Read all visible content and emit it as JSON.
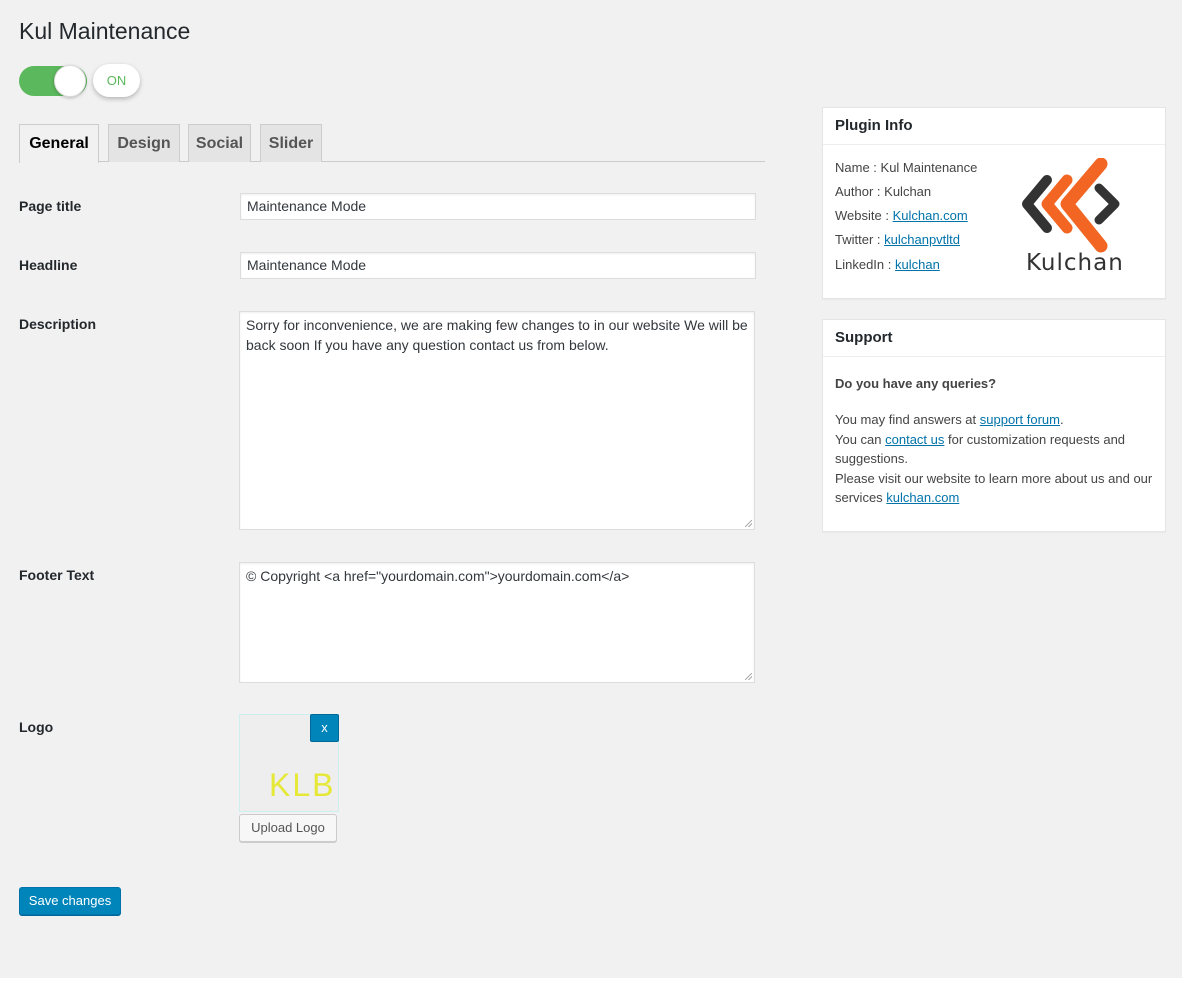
{
  "page": {
    "title": "Kul Maintenance"
  },
  "toggle": {
    "state_label": "ON",
    "on_color": "#5cb85c"
  },
  "tabs": [
    {
      "label": "General",
      "active": true
    },
    {
      "label": "Design",
      "active": false
    },
    {
      "label": "Social",
      "active": false
    },
    {
      "label": "Slider",
      "active": false
    }
  ],
  "form": {
    "page_title": {
      "label": "Page title",
      "value": "Maintenance Mode"
    },
    "headline": {
      "label": "Headline",
      "value": "Maintenance Mode"
    },
    "description": {
      "label": "Description",
      "value": "Sorry for inconvenience, we are making few changes to in our website We will be back soon If you have any question contact us from below."
    },
    "footer_text": {
      "label": "Footer Text",
      "value": "© Copyright <a href=\"yourdomain.com\">yourdomain.com</a>"
    },
    "logo": {
      "label": "Logo",
      "preview_text": "KLB",
      "remove_label": "x",
      "upload_label": "Upload Logo"
    },
    "save_label": "Save changes"
  },
  "plugin_info": {
    "title": "Plugin Info",
    "name_label": "Name :",
    "name_value": "Kul Maintenance",
    "author_label": "Author :",
    "author_value": "Kulchan",
    "website_label": "Website :",
    "website_value": "Kulchan.com",
    "twitter_label": "Twitter :",
    "twitter_value": "kulchanpvtltd",
    "linkedin_label": "LinkedIn :",
    "linkedin_value": "kulchan",
    "logo_text": "Kulchan",
    "logo_colors": {
      "dark": "#333333",
      "accent": "#f26522"
    }
  },
  "support": {
    "title": "Support",
    "question": "Do you have any queries?",
    "line1_prefix": "You may find answers at ",
    "line1_link": "support forum",
    "line1_suffix": ".",
    "line2_prefix": "You can ",
    "line2_link": "contact us",
    "line2_suffix": " for customization requests and suggestions.",
    "line3_prefix": "Please visit our website to learn more about us and our services ",
    "line3_link": "kulchan.com"
  }
}
